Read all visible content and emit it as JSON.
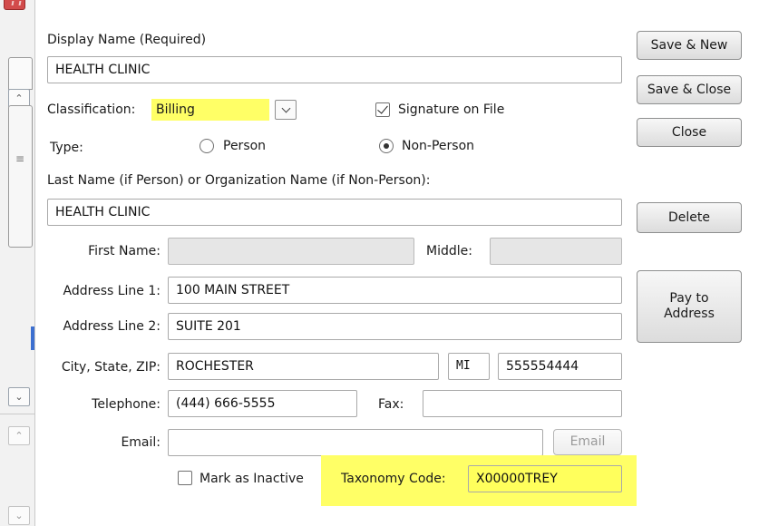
{
  "form": {
    "display_name_label": "Display Name (Required)",
    "display_name_value": "HEALTH CLINIC",
    "classification_label": "Classification:",
    "classification_value": "Billing",
    "signature_label": "Signature on File",
    "signature_checked": true,
    "type_label": "Type:",
    "type_person_label": "Person",
    "type_nonperson_label": "Non-Person",
    "type_selected": "Non-Person",
    "lastname_label": "Last Name (if Person) or Organization Name (if Non-Person):",
    "lastname_value": "HEALTH CLINIC",
    "firstname_label": "First Name:",
    "firstname_value": "",
    "middle_label": "Middle:",
    "middle_value": "",
    "address1_label": "Address Line 1:",
    "address1_value": "100 MAIN STREET",
    "address2_label": "Address Line 2:",
    "address2_value": "SUITE 201",
    "citystatezip_label": "City, State, ZIP:",
    "city_value": "ROCHESTER",
    "state_value": "MI",
    "zip_value": "555554444",
    "telephone_label": "Telephone:",
    "telephone_value": "(444) 666-5555",
    "fax_label": "Fax:",
    "fax_value": "",
    "email_label": "Email:",
    "email_value": "",
    "email_button": "Email",
    "inactive_label": "Mark as Inactive",
    "inactive_checked": false,
    "taxonomy_label": "Taxonomy Code:",
    "taxonomy_value": "X00000TREY"
  },
  "buttons": {
    "save_new": "Save & New",
    "save_close": "Save & Close",
    "close": "Close",
    "delete": "Delete",
    "pay_to_line1": "Pay to",
    "pay_to_line2": "Address"
  },
  "icons": {
    "scroll_up": "chevron-up-icon",
    "scroll_down": "chevron-down-icon",
    "grip": "grip-icon",
    "dropdown": "chevron-down-icon"
  },
  "colors": {
    "highlight": "#ffff66",
    "disabled_field": "#e6e6e6"
  }
}
